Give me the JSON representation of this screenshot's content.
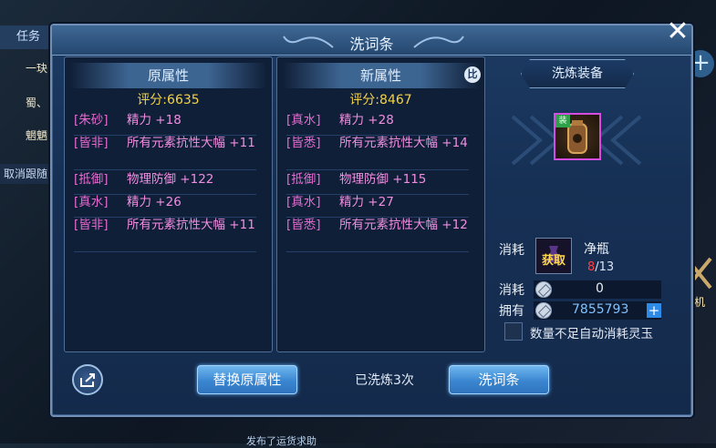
{
  "background": {
    "task_tab": "任务",
    "team_rows": [
      "一玦",
      "蜀、",
      "魍魉"
    ],
    "cancel_follow": "取消跟随",
    "hang_label": "挂机",
    "chat_line": "发布了运货求助"
  },
  "dialog": {
    "title": "洗词条",
    "original": {
      "header": "原属性",
      "score_label": "评分:",
      "score": "6635",
      "attrs": [
        {
          "tag": "[朱砂]",
          "value": "精力 +18"
        },
        {
          "tag": "[皆非]",
          "value": "所有元素抗性大幅 +11"
        },
        {
          "tag": "[抵御]",
          "value": "物理防御 +122"
        },
        {
          "tag": "[真水]",
          "value": "精力 +26"
        },
        {
          "tag": "[皆非]",
          "value": "所有元素抗性大幅 +11"
        }
      ]
    },
    "new": {
      "header": "新属性",
      "compare_label": "比",
      "score_label": "评分:",
      "score": "8467",
      "attrs": [
        {
          "tag": "[真水]",
          "value": "精力 +28"
        },
        {
          "tag": "[皆悉]",
          "value": "所有元素抗性大幅 +14"
        },
        {
          "tag": "[抵御]",
          "value": "物理防御 +115"
        },
        {
          "tag": "[真水]",
          "value": "精力 +27"
        },
        {
          "tag": "[皆悉]",
          "value": "所有元素抗性大幅 +12"
        }
      ]
    },
    "equip": {
      "title": "洗炼装备",
      "badge": "装"
    },
    "material": {
      "consume_label": "消耗",
      "get_label": "获取",
      "name": "净瓶",
      "have": "8",
      "need": "/13"
    },
    "cost": {
      "consume_label": "消耗",
      "value": "0",
      "own_label": "拥有",
      "own_value": "7855793"
    },
    "auto_consume_label": "数量不足自动消耗灵玉",
    "replace_button": "替换原属性",
    "wash_count": "已洗炼3次",
    "wash_button": "洗词条"
  }
}
